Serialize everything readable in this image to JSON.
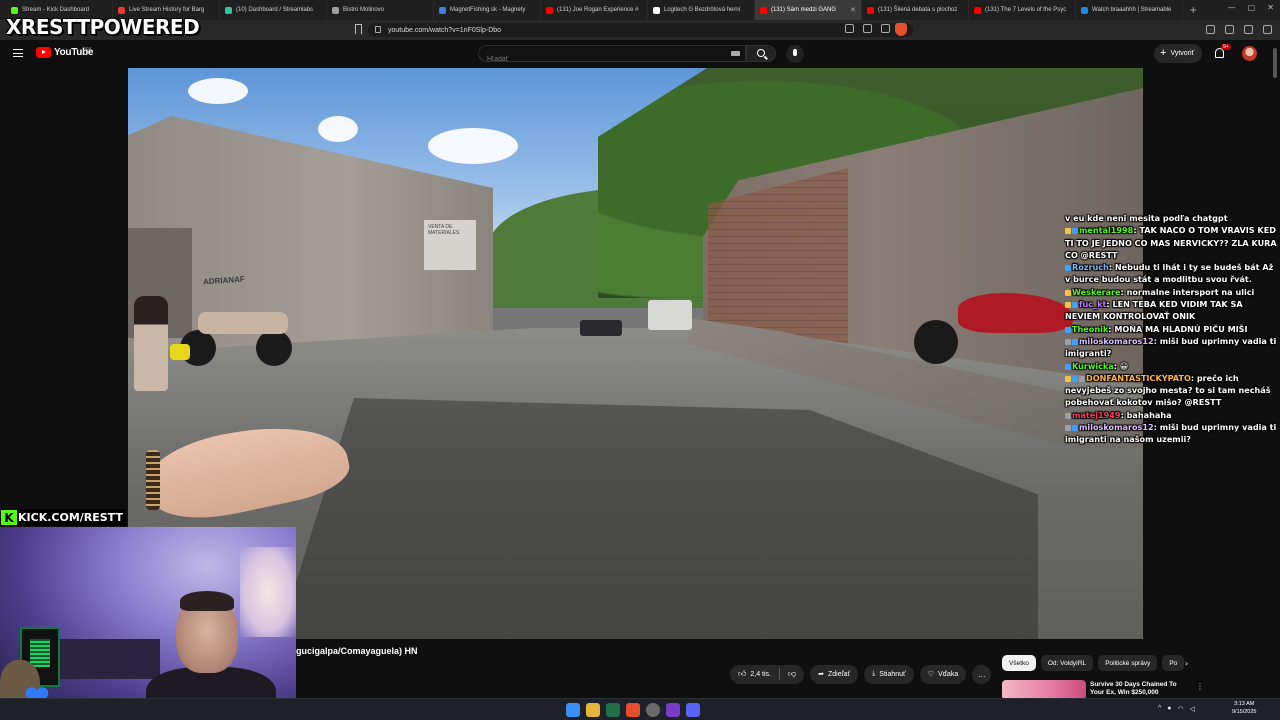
{
  "browser": {
    "tabs": [
      {
        "label": "Stream - Kick Dashboard",
        "color": "#53fc18"
      },
      {
        "label": "Live Stream History for Barg",
        "color": "#e53935"
      },
      {
        "label": "(10) Dashboard / Streamlabs",
        "color": "#31c3a2"
      },
      {
        "label": "Bistro Molinovo",
        "color": "#9e9e9e"
      },
      {
        "label": "MagnetFishing.sk - Magnety",
        "color": "#3f7fe0"
      },
      {
        "label": "(131) Joe Rogan Experience #",
        "color": "#ff0000"
      },
      {
        "label": "Logitech G Bezdrôtová herní",
        "color": "#ffffff"
      },
      {
        "label": "(131) Sám medzi GANG",
        "color": "#ff0000",
        "active": true
      },
      {
        "label": "(131) Šilená debata s plochoz",
        "color": "#ff0000"
      },
      {
        "label": "(131) The 7 Levels of the Psyc",
        "color": "#ff0000"
      },
      {
        "label": "Watch braaahhh | Streamable",
        "color": "#1e88e5"
      }
    ],
    "url": "youtube.com/watch?v=1nF0Slp-Dbo"
  },
  "overlay": {
    "brand": "XRESTTPOWERED",
    "kick_k": "K",
    "kick_url": "KICK.COM/RESTT"
  },
  "youtube": {
    "logo_text": "YouTube",
    "region": "SK",
    "search_placeholder": "Hľadať",
    "create_label": "Vytvoriť",
    "notif_count": "9+",
    "video_title": "gucigalpa/Comayaguela) HN",
    "like_count": "2,4 tis.",
    "share_label": "Zdieľať",
    "download_label": "Stiahnuť",
    "thanks_label": "Vďaka",
    "more_label": "…",
    "chips": [
      "Všetko",
      "Od: VoldyIRL",
      "Politické správy",
      "Po"
    ],
    "chip_next": "›",
    "rec_title": "Survive 30 Days Chained To Your Ex, Win $250,000",
    "rec_more": "⋮"
  },
  "video_scene": {
    "graffiti": "ADRIANAF",
    "sign_text": "VENTA DE MATERIALES"
  },
  "chat": [
    {
      "user": "",
      "color": "#ffffff",
      "badges": [],
      "text": "v eu kde neni mesita podľa chatgpt"
    },
    {
      "user": "mental1998",
      "color": "#53fc18",
      "badges": [
        "#f5c242",
        "#3fa0ff"
      ],
      "text": "TAK NACO O TOM VRAVIS KED TI TO JE JEDNO CO MAS NERVICKY?? ZLA KURA CO @RESTT"
    },
    {
      "user": "Rozruch",
      "color": "#7fb8ff",
      "badges": [
        "#3fa0ff"
      ],
      "text": "Nebudu ti lhát i ty se budeš bát Až v burce budou stát a modlitbu svou řvát."
    },
    {
      "user": "Weskerare",
      "color": "#53fc18",
      "badges": [
        "#f5c242"
      ],
      "text": "normalne intersport na ulici"
    },
    {
      "user": "fuc_kt",
      "color": "#c07bff",
      "badges": [
        "#f5c242",
        "#3fa0ff"
      ],
      "text": "LEN TEBA KED VIDIM TAK SA NEVIEM KONTROLOVAŤ ONIK"
    },
    {
      "user": "Theonik",
      "color": "#53fc18",
      "badges": [
        "#3fa0ff"
      ],
      "text": "MOŇA MA HLADNÚ PIČU MIŠI"
    },
    {
      "user": "miloskomaros12",
      "color": "#dfc0ff",
      "badges": [
        "#9aa0a6",
        "#3fa0ff"
      ],
      "text": "miši bud uprimny vadia ti imigranti?"
    },
    {
      "user": "Kurwicka",
      "color": "#53fc18",
      "badges": [
        "#3fa0ff"
      ],
      "text": "😀"
    },
    {
      "user": "DONFANTASTICKYPATO",
      "color": "#ffb443",
      "badges": [
        "#f5c242",
        "#3fa0ff",
        "#9aa0a6"
      ],
      "text": "prečo ich nevyjebeš zo svojho mesta? to si tam necháš pobehovať kokotov mišo? @RESTT"
    },
    {
      "user": "matej1949",
      "color": "#ff3b5c",
      "badges": [
        "#9aa0a6"
      ],
      "text": "bahahaha"
    },
    {
      "user": "miloskomaros12",
      "color": "#dfc0ff",
      "badges": [
        "#9aa0a6",
        "#3fa0ff"
      ],
      "text": "miši bud uprimny vadia ti imigranti na našom uzemii?"
    }
  ],
  "taskbar": {
    "time": "3:13 AM",
    "date": "9/15/2025",
    "tray_lang": "^"
  },
  "colors": {
    "yt_red": "#ff0000",
    "kick_green": "#53fc18",
    "background": "#0f0f0f"
  }
}
